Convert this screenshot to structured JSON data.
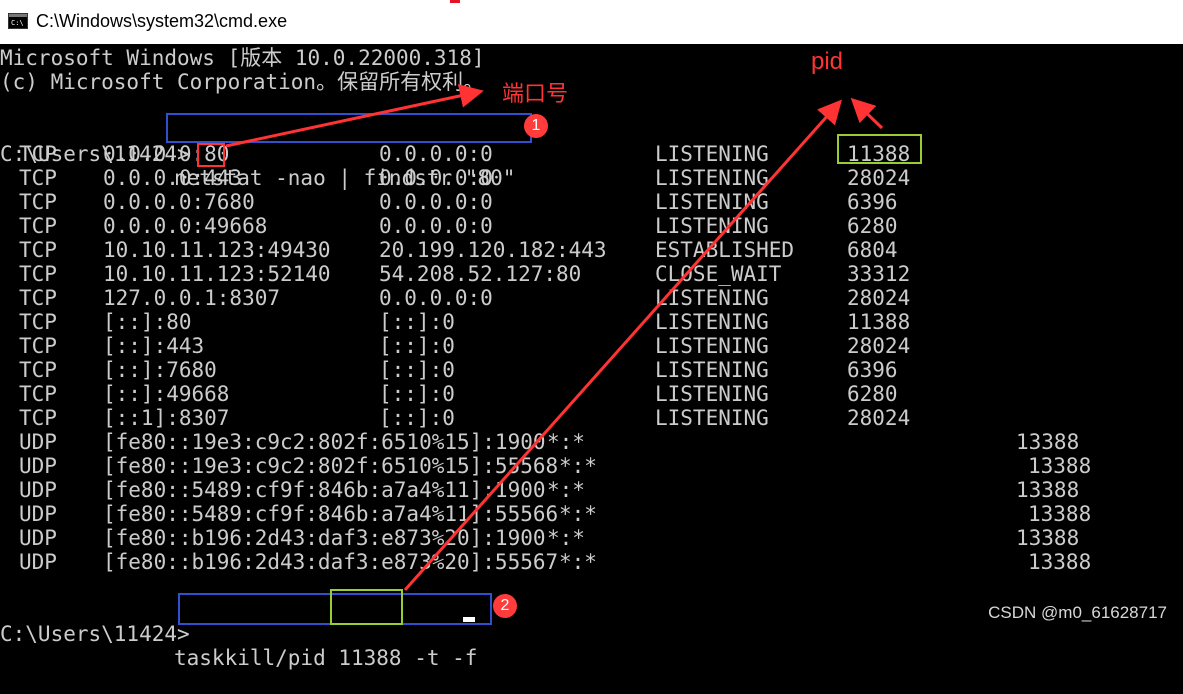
{
  "window": {
    "title": "C:\\Windows\\system32\\cmd.exe",
    "icon": "cmd-icon"
  },
  "console": {
    "header_lines": [
      "Microsoft Windows [版本 10.0.22000.318]",
      "(c) Microsoft Corporation。保留所有权利。"
    ],
    "prompt": "C:\\Users\\11424>",
    "command1": "netstat -nao | findstr \"80\"",
    "rows": [
      {
        "proto": "TCP",
        "local": "0.0.0.0:80",
        "foreign": "0.0.0.0:0",
        "state": "LISTENING",
        "pid": "11388"
      },
      {
        "proto": "TCP",
        "local": "0.0.0.0:443",
        "foreign": "0.0.0.0:0",
        "state": "LISTENING",
        "pid": "28024"
      },
      {
        "proto": "TCP",
        "local": "0.0.0.0:7680",
        "foreign": "0.0.0.0:0",
        "state": "LISTENING",
        "pid": "6396"
      },
      {
        "proto": "TCP",
        "local": "0.0.0.0:49668",
        "foreign": "0.0.0.0:0",
        "state": "LISTENING",
        "pid": "6280"
      },
      {
        "proto": "TCP",
        "local": "10.10.11.123:49430",
        "foreign": "20.199.120.182:443",
        "state": "ESTABLISHED",
        "pid": "6804"
      },
      {
        "proto": "TCP",
        "local": "10.10.11.123:52140",
        "foreign": "54.208.52.127:80",
        "state": "CLOSE_WAIT",
        "pid": "33312"
      },
      {
        "proto": "TCP",
        "local": "127.0.0.1:8307",
        "foreign": "0.0.0.0:0",
        "state": "LISTENING",
        "pid": "28024"
      },
      {
        "proto": "TCP",
        "local": "[::]:80",
        "foreign": "[::]:0",
        "state": "LISTENING",
        "pid": "11388"
      },
      {
        "proto": "TCP",
        "local": "[::]:443",
        "foreign": "[::]:0",
        "state": "LISTENING",
        "pid": "28024"
      },
      {
        "proto": "TCP",
        "local": "[::]:7680",
        "foreign": "[::]:0",
        "state": "LISTENING",
        "pid": "6396"
      },
      {
        "proto": "TCP",
        "local": "[::]:49668",
        "foreign": "[::]:0",
        "state": "LISTENING",
        "pid": "6280"
      },
      {
        "proto": "TCP",
        "local": "[::1]:8307",
        "foreign": "[::]:0",
        "state": "LISTENING",
        "pid": "28024"
      }
    ],
    "udp_rows": [
      {
        "proto": "UDP",
        "local": "[fe80::19e3:c9c2:802f:6510%15]:1900",
        "foreign": "*:*",
        "pid": "13388"
      },
      {
        "proto": "UDP",
        "local": "[fe80::19e3:c9c2:802f:6510%15]:55568",
        "foreign": "*:*",
        "pid": "13388"
      },
      {
        "proto": "UDP",
        "local": "[fe80::5489:cf9f:846b:a7a4%11]:1900",
        "foreign": "*:*",
        "pid": "13388"
      },
      {
        "proto": "UDP",
        "local": "[fe80::5489:cf9f:846b:a7a4%11]:55566",
        "foreign": "*:*",
        "pid": "13388"
      },
      {
        "proto": "UDP",
        "local": "[fe80::b196:2d43:daf3:e873%20]:1900",
        "foreign": "*:*",
        "pid": "13388"
      },
      {
        "proto": "UDP",
        "local": "[fe80::b196:2d43:daf3:e873%20]:55567",
        "foreign": "*:*",
        "pid": "13388"
      }
    ],
    "command2": "taskkill/pid 11388 -t -f"
  },
  "annotations": {
    "port_label": "端口号",
    "pid_label": "pid",
    "badge1": "1",
    "badge2": "2",
    "red_color": "#ff3333",
    "blue_color": "#3050d0",
    "green_color": "#9acd32"
  },
  "watermark": "CSDN @m0_61628717"
}
